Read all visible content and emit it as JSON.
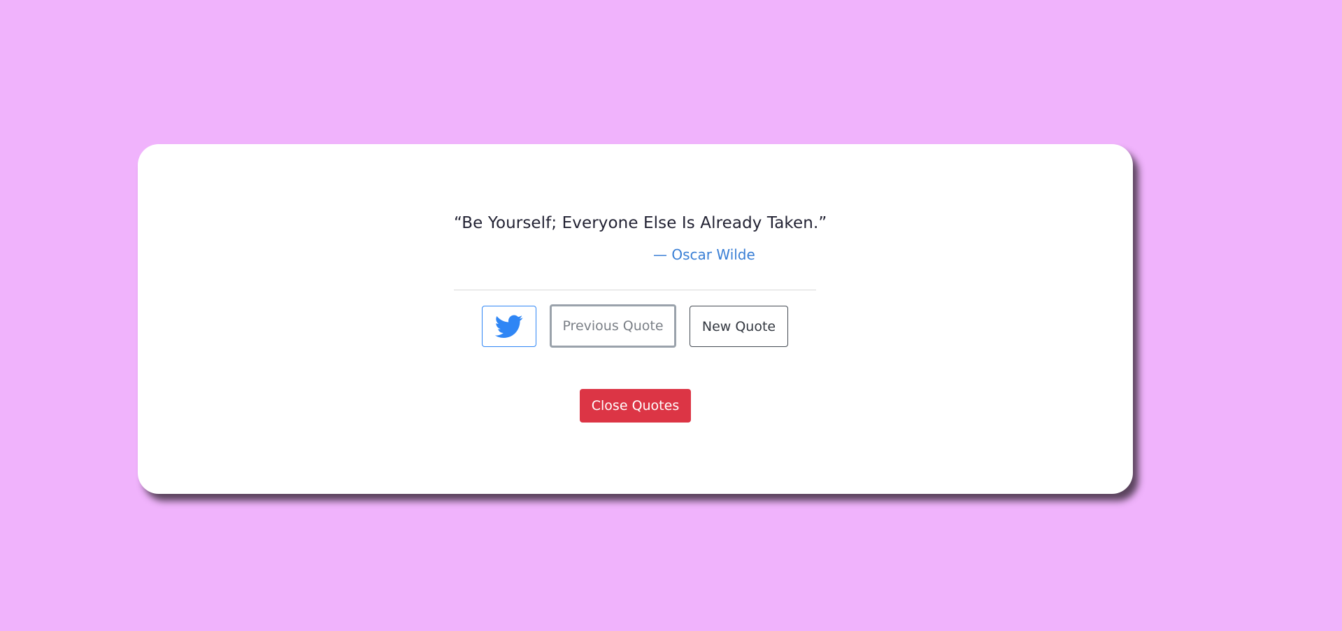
{
  "quote": {
    "text": "“Be Yourself; Everyone Else Is Already Taken.”",
    "author": "— Oscar Wilde"
  },
  "actions": {
    "twitter_icon": "twitter-bird-icon",
    "previous_label": "Previous Quote",
    "new_label": "New Quote",
    "close_label": "Close Quotes"
  },
  "colors": {
    "background": "#f0b3fc",
    "card": "#ffffff",
    "author": "#3a7fd5",
    "twitter": "#2f86f5",
    "close": "#dc3545"
  }
}
